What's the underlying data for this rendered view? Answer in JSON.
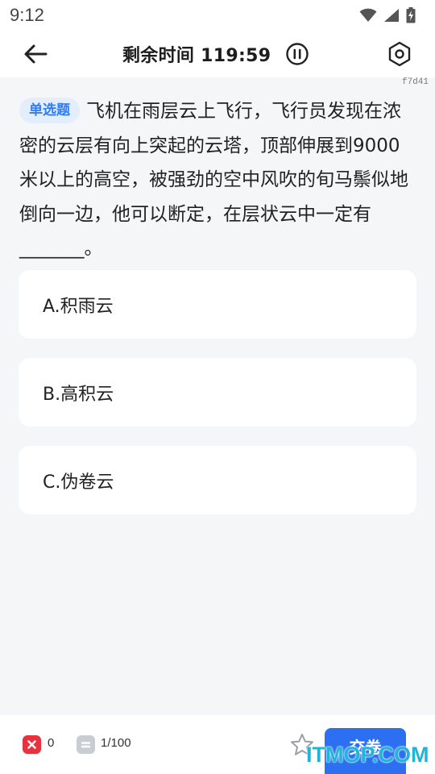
{
  "status_bar": {
    "time": "9:12",
    "icons": [
      "wifi-icon",
      "cell-signal-icon",
      "battery-charging-icon"
    ]
  },
  "header": {
    "back_icon": "arrow-left-icon",
    "timer_label": "剩余时间 119:59",
    "pause_icon": "pause-circle-icon",
    "settings_icon": "settings-hexagon-icon"
  },
  "question_code": "f7d41",
  "question": {
    "type_tag": "单选题",
    "text": "飞机在雨层云上飞行，飞行员发现在浓密的云层有向上突起的云塔，顶部伸展到9000米以上的高空，被强劲的空中风吹的旬马鬃似地倒向一边，他可以断定，在层状云中一定有_______。"
  },
  "options": [
    {
      "label": "A.积雨云"
    },
    {
      "label": "B.高积云"
    },
    {
      "label": "C.伪卷云"
    }
  ],
  "footer": {
    "wrong_count": "0",
    "progress": "1/100",
    "submit_label": "交卷",
    "star_icon": "star-outline-icon"
  },
  "watermark": "ITMOP.COM",
  "colors": {
    "accent": "#2c6ff0",
    "tag_bg": "#e3eefc",
    "tag_text": "#2f7cf6",
    "wrong": "#e9323f",
    "answered": "#c8ccd3",
    "background": "#f5f6f8"
  }
}
